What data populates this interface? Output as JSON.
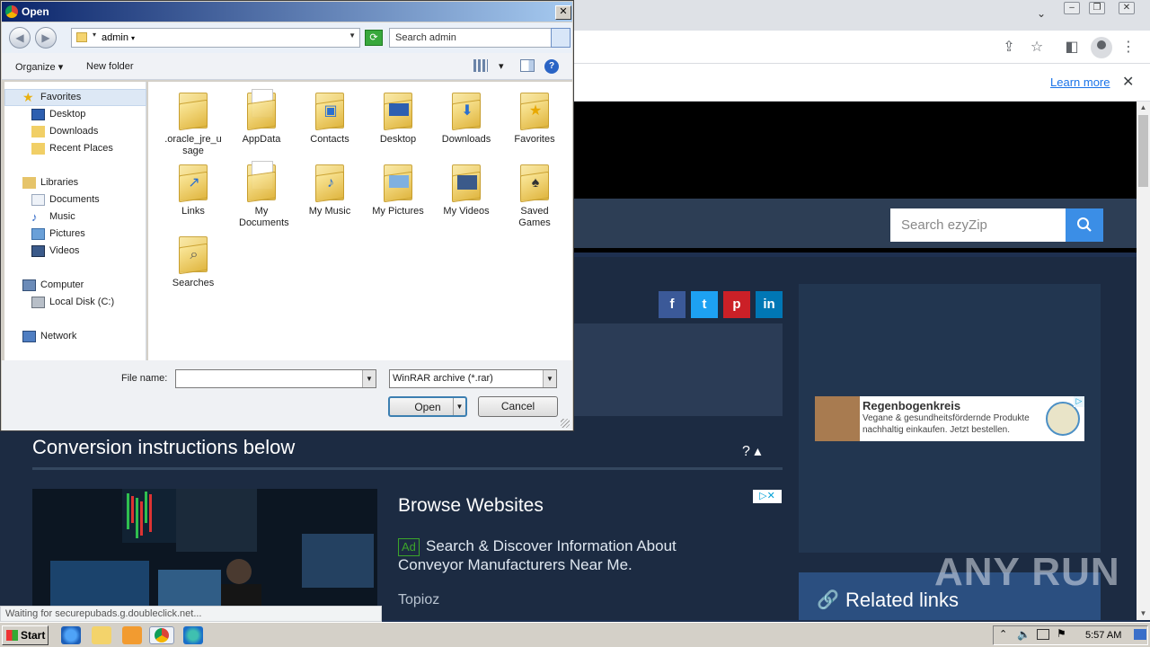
{
  "browser": {
    "learn_more": "Learn more"
  },
  "site": {
    "search_placeholder": "Search ezyZip",
    "social": [
      "f",
      "t",
      "p",
      "in"
    ],
    "conversion_title": "Conversion instructions below",
    "conversion_toggle": "?",
    "ad": {
      "title": "Browse Websites",
      "badge": "Ad",
      "text": "Search & Discover Information About Conveyor Manufacturers Near Me.",
      "source": "Topioz"
    },
    "banner": {
      "title": "Regenbogenkreis",
      "text": "Vegane & gesundheitsfördernde Produkte nachhaltig einkaufen. Jetzt bestellen."
    },
    "related_links": "Related links",
    "status": "Waiting for securepubads.g.doubleclick.net..."
  },
  "watermark": "ANY RUN",
  "dialog": {
    "title": "Open",
    "address": "admin",
    "search_placeholder": "Search admin",
    "organize": "Organize",
    "new_folder": "New folder",
    "nav": {
      "favorites": "Favorites",
      "desktop": "Desktop",
      "downloads": "Downloads",
      "recent_places": "Recent Places",
      "libraries": "Libraries",
      "documents": "Documents",
      "music": "Music",
      "pictures": "Pictures",
      "videos": "Videos",
      "computer": "Computer",
      "local_disk": "Local Disk (C:)",
      "network": "Network"
    },
    "files": [
      {
        "name": ".oracle_jre_usage"
      },
      {
        "name": "AppData"
      },
      {
        "name": "Contacts"
      },
      {
        "name": "Desktop"
      },
      {
        "name": "Downloads"
      },
      {
        "name": "Favorites"
      },
      {
        "name": "Links"
      },
      {
        "name": "My Documents"
      },
      {
        "name": "My Music"
      },
      {
        "name": "My Pictures"
      },
      {
        "name": "My Videos"
      },
      {
        "name": "Saved Games"
      },
      {
        "name": "Searches"
      }
    ],
    "file_name_label": "File name:",
    "file_name_value": "",
    "file_type": "WinRAR archive (*.rar)",
    "open_button": "Open",
    "cancel_button": "Cancel"
  },
  "taskbar": {
    "start": "Start",
    "clock": "5:57 AM"
  }
}
